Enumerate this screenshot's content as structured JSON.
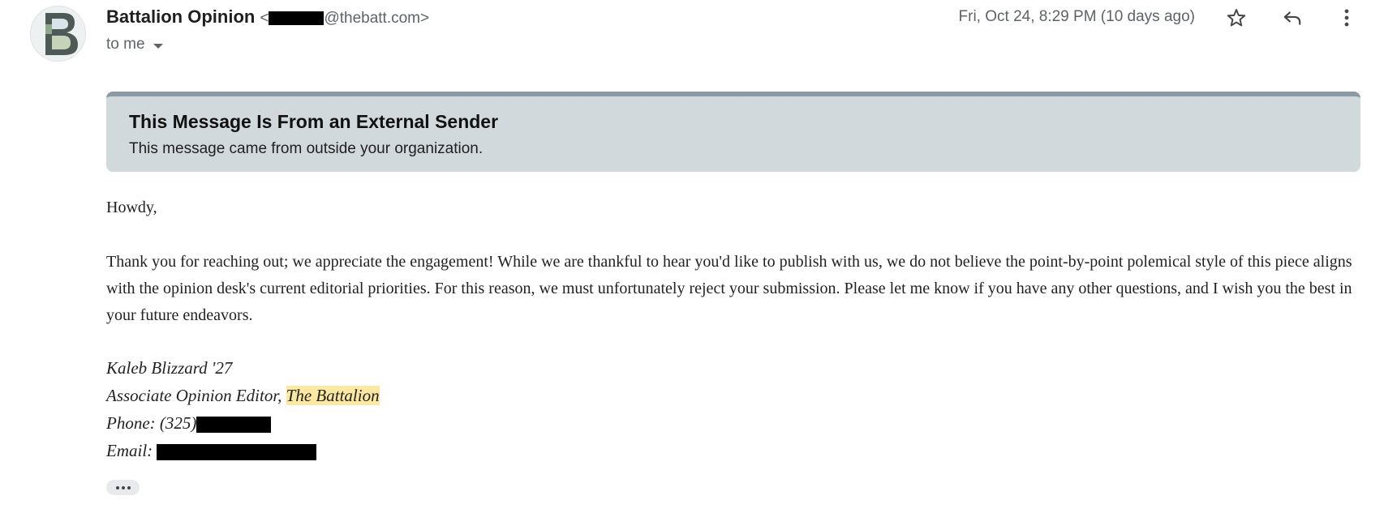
{
  "sender": {
    "name": "Battalion Opinion",
    "email_prefix": "<",
    "email_suffix": "@thebatt.com>",
    "avatar_letter": "B"
  },
  "recipient": {
    "label": "to me"
  },
  "date": "Fri, Oct 24, 8:29 PM (10 days ago)",
  "actions": {
    "star": "star-icon",
    "reply": "reply-icon",
    "more": "more-vert-icon"
  },
  "banner": {
    "title": "This Message Is From an External Sender",
    "text": "This message came from outside your organization."
  },
  "body": {
    "greeting": "Howdy,",
    "paragraph": "Thank you for reaching out; we appreciate the engagement! While we are thankful to hear you'd like to publish with us, we do not believe the point-by-point polemical style of this piece aligns with the opinion desk's current editorial priorities. For this reason, we must unfortunately reject your submission. Please let me know if you have any other questions, and I wish you the best in your future endeavors."
  },
  "signature": {
    "name": "Kaleb Blizzard '27",
    "title_prefix": "Associate Opinion Editor, ",
    "publication": "The Battalion",
    "phone_label": "Phone: (325)",
    "email_label": "Email: "
  },
  "colors": {
    "banner_bg": "#d2d9dd",
    "banner_border": "#8a9ba6",
    "highlight": "#fce8a0",
    "link": "#1a73e8"
  }
}
